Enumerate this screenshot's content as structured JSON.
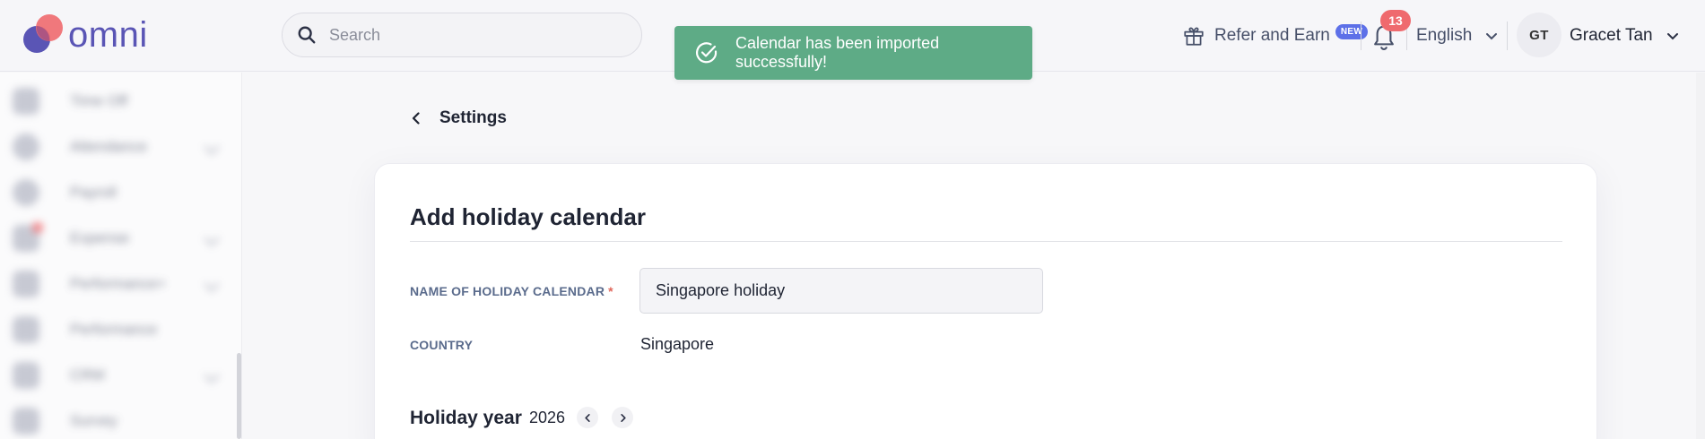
{
  "header": {
    "logo_text": "omni",
    "search_placeholder": "Search",
    "refer_label": "Refer and Earn",
    "new_badge": "NEW",
    "notification_count": "13",
    "language": "English",
    "user_initials": "GT",
    "user_name": "Gracet Tan"
  },
  "toast": {
    "message": "Calendar has been imported successfully!"
  },
  "sidebar": {
    "items": [
      {
        "label": "Time Off",
        "has_chevron": false
      },
      {
        "label": "Attendance",
        "has_chevron": true
      },
      {
        "label": "Payroll",
        "has_chevron": false
      },
      {
        "label": "Expense",
        "has_chevron": true
      },
      {
        "label": "Performance+",
        "has_chevron": true
      },
      {
        "label": "Performance",
        "has_chevron": false
      },
      {
        "label": "CRM",
        "has_chevron": true
      },
      {
        "label": "Survey",
        "has_chevron": false
      }
    ]
  },
  "main": {
    "back_label": "Settings",
    "card_title": "Add holiday calendar",
    "name_label": "NAME OF HOLIDAY CALENDAR",
    "required_mark": "*",
    "name_value": "Singapore holiday",
    "country_label": "COUNTRY",
    "country_value": "Singapore",
    "holiday_year_label": "Holiday year",
    "holiday_year_value": "2026"
  },
  "colors": {
    "brand": "#5a55b5",
    "brand_accent": "#ef6a6e",
    "toast_bg": "#5eab86",
    "badge_blue": "#5d70e8",
    "label_blue": "#5a6b8c"
  },
  "icons": [
    "search-icon",
    "check-circle-icon",
    "gift-icon",
    "bell-icon",
    "chevron-down-icon",
    "chevron-left-icon",
    "chevron-right-icon"
  ]
}
